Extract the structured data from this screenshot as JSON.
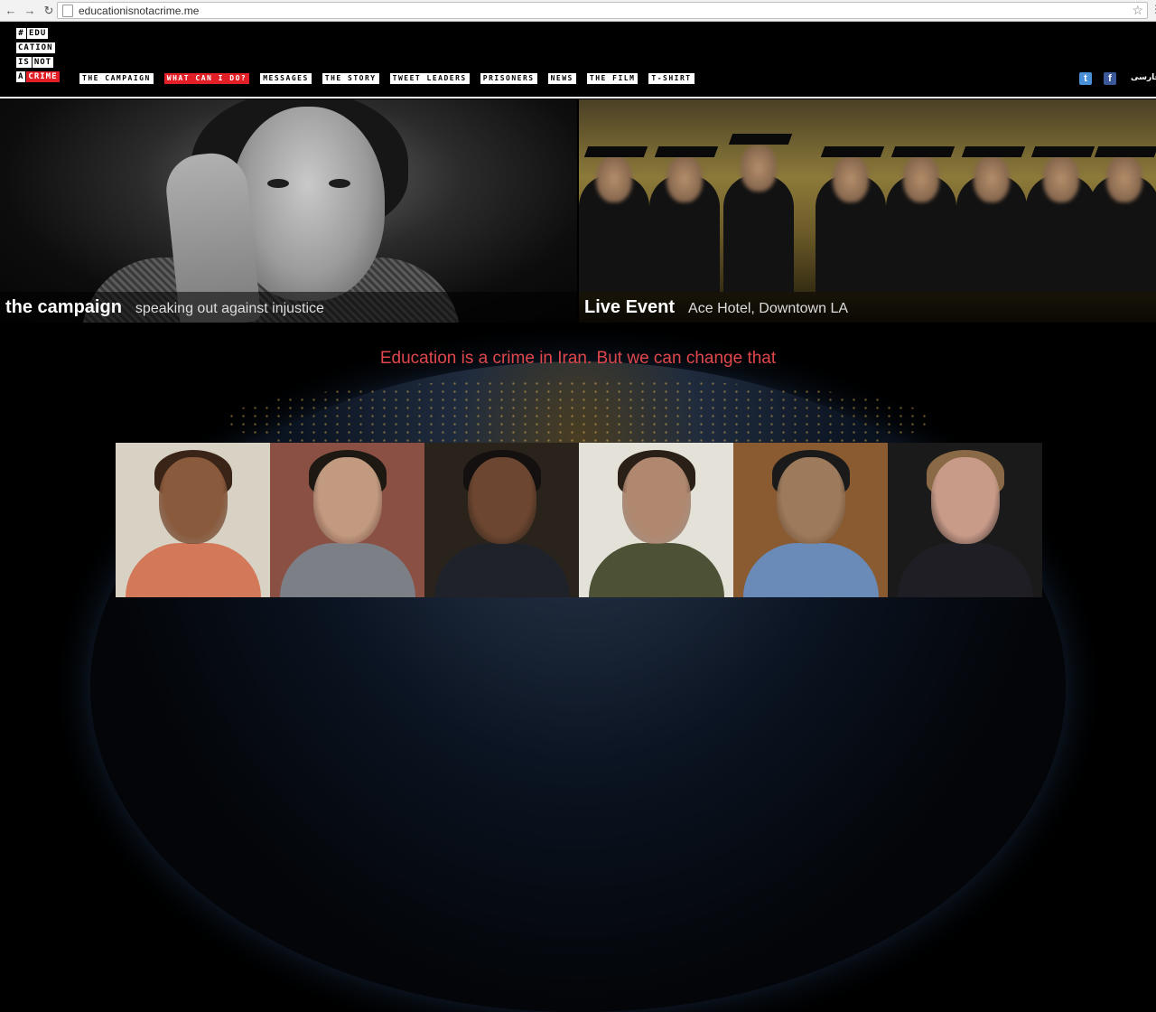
{
  "browser": {
    "url": "educationisnotacrime.me",
    "back_glyph": "←",
    "forward_glyph": "→",
    "reload_glyph": "↻",
    "star_glyph": "☆"
  },
  "logo": {
    "lines": [
      [
        "#",
        "EDU"
      ],
      [
        "CATION"
      ],
      [
        "IS",
        "NOT"
      ],
      [
        "A",
        "CRIME"
      ]
    ]
  },
  "nav": {
    "items": [
      {
        "label": "THE CAMPAIGN",
        "active": false
      },
      {
        "label": "WHAT CAN I DO?",
        "active": true
      },
      {
        "label": "MESSAGES",
        "active": false
      },
      {
        "label": "THE STORY",
        "active": false
      },
      {
        "label": "TWEET LEADERS",
        "active": false
      },
      {
        "label": "PRISONERS",
        "active": false
      },
      {
        "label": "NEWS",
        "active": false
      },
      {
        "label": "THE FILM",
        "active": false
      },
      {
        "label": "T-SHIRT",
        "active": false
      }
    ]
  },
  "social": {
    "twitter_icon": "twitter-icon",
    "twitter_glyph": "t",
    "facebook_icon": "facebook-icon",
    "facebook_glyph": "f",
    "language_label": "فارسی"
  },
  "hero": {
    "left": {
      "title": "the campaign",
      "subtitle": "speaking out against injustice"
    },
    "right": {
      "title": "Live Event",
      "subtitle": "Ace Hotel, Downtown LA"
    }
  },
  "tagline": "Education is a crime in Iran. But we can change that",
  "colors": {
    "accent_red": "#e21f26",
    "tagline_red": "#e0474c",
    "background": "#000000"
  },
  "videos": [
    {
      "skin": "#8a5a3c",
      "hair": "#3a2418",
      "body": "#d4785a",
      "bg": "#d8d2c4"
    },
    {
      "skin": "#c29a80",
      "hair": "#1e1812",
      "body": "#7d7f86",
      "bg": "#8a5044"
    },
    {
      "skin": "#6c4630",
      "hair": "#141010",
      "body": "#1f2228",
      "bg": "#2a231c"
    },
    {
      "skin": "#b08870",
      "hair": "#2a2018",
      "body": "#4d5236",
      "bg": "#e4e2d8"
    },
    {
      "skin": "#9e7a5c",
      "hair": "#1a1a1a",
      "body": "#6a8ab8",
      "bg": "#8a5a30"
    },
    {
      "skin": "#c89a88",
      "hair": "#8a6a46",
      "body": "#1e1e24",
      "bg": "#1a1a1a"
    }
  ]
}
